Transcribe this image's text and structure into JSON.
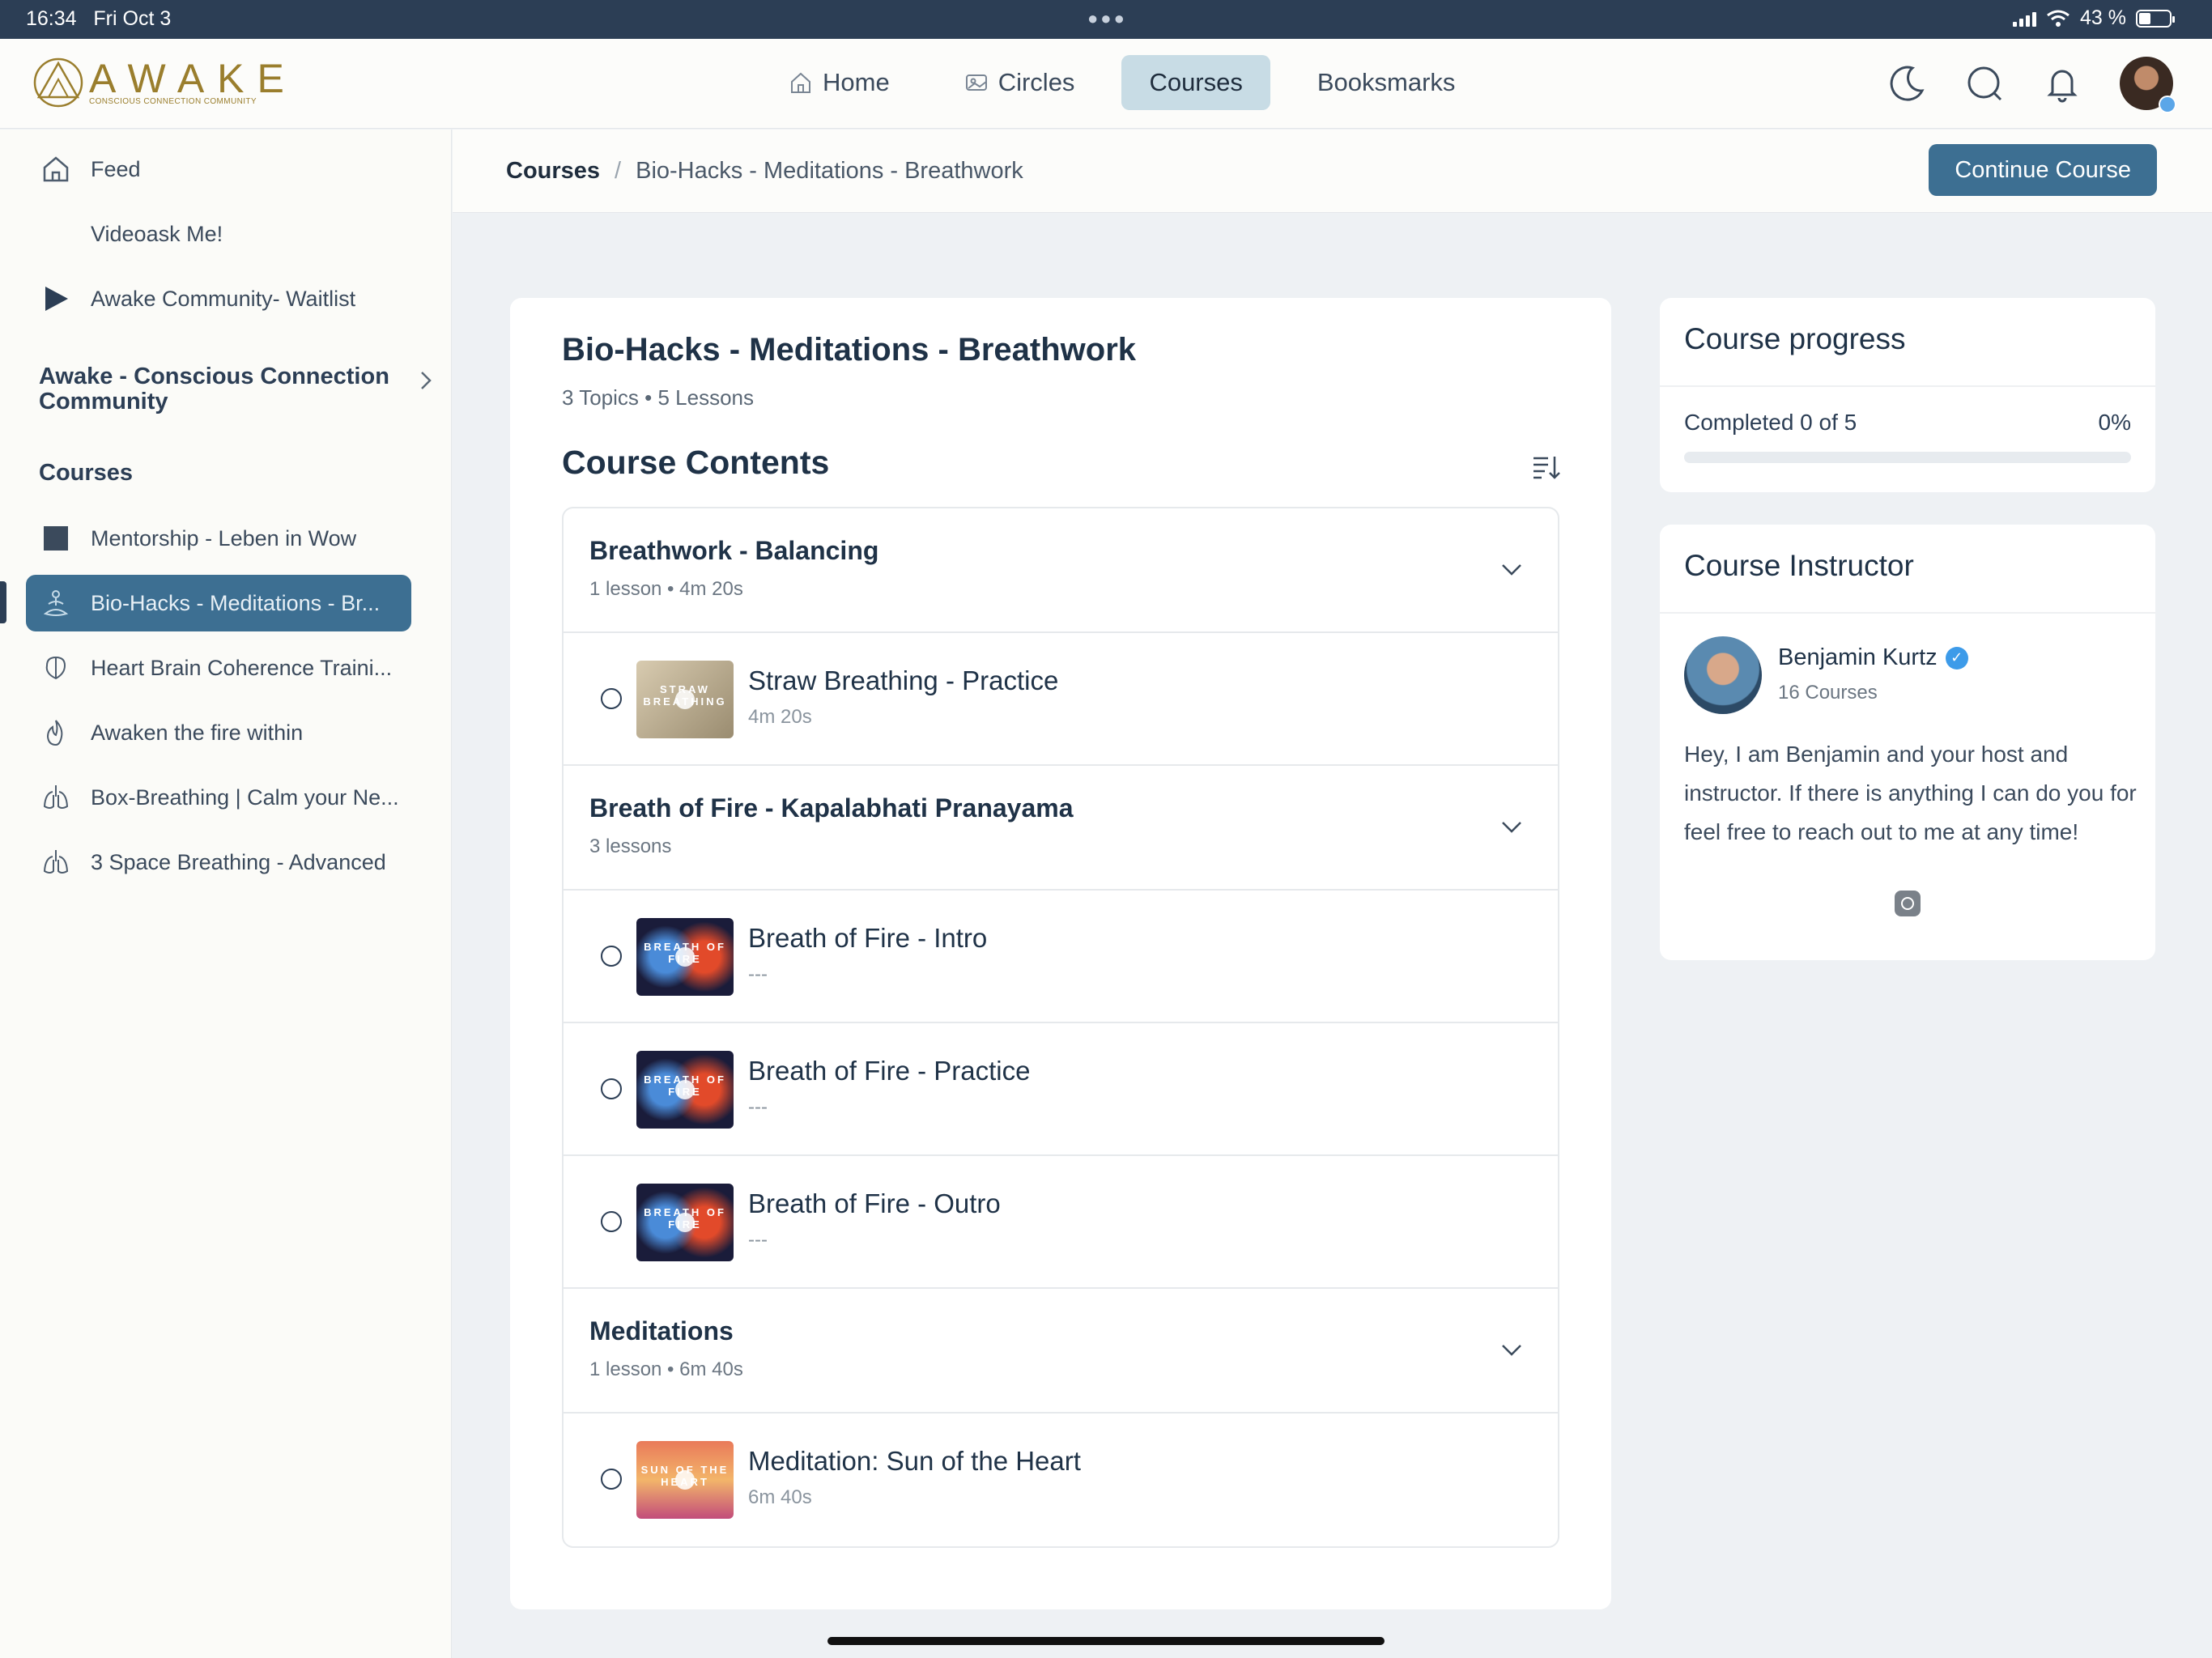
{
  "status": {
    "time": "16:34",
    "date": "Fri Oct 3",
    "battery": "43 %"
  },
  "brand": {
    "name": "AWAKE",
    "tagline": "CONSCIOUS CONNECTION COMMUNITY",
    "color": "#9a7e2d"
  },
  "nav": {
    "items": [
      {
        "label": "Home",
        "icon": "home-icon"
      },
      {
        "label": "Circles",
        "icon": "image-icon"
      },
      {
        "label": "Courses",
        "active": true
      },
      {
        "label": "Booksmarks"
      }
    ],
    "right_icons": [
      "moon-icon",
      "search-icon",
      "bell-icon",
      "avatar"
    ]
  },
  "sidebar": {
    "items": [
      {
        "label": "Feed",
        "icon": "home-icon"
      },
      {
        "label": "Videoask Me!"
      },
      {
        "label": "Awake Community- Waitlist",
        "icon": "play-icon"
      }
    ],
    "community": "Awake - Conscious Connection Community",
    "courses_heading": "Courses",
    "courses": [
      {
        "label": "Mentorship - Leben in Wow",
        "icon": "square-icon"
      },
      {
        "label": "Bio-Hacks - Meditations - Br...",
        "icon": "meditation-icon",
        "active": true
      },
      {
        "label": "Heart Brain Coherence Traini...",
        "icon": "brain-icon"
      },
      {
        "label": "Awaken the fire within",
        "icon": "flame-icon"
      },
      {
        "label": "Box-Breathing | Calm your Ne...",
        "icon": "lungs-icon"
      },
      {
        "label": "3 Space Breathing - Advanced",
        "icon": "lungs-icon"
      }
    ]
  },
  "breadcrumb": {
    "root": "Courses",
    "separator": "/",
    "current": "Bio-Hacks - Meditations - Breathwork"
  },
  "continue_label": "Continue Course",
  "course": {
    "title": "Bio-Hacks - Meditations - Breathwork",
    "meta": "3 Topics • 5 Lessons",
    "contents_title": "Course Contents",
    "topics": [
      {
        "name": "Breathwork - Balancing",
        "meta": "1 lesson • 4m 20s",
        "lessons": [
          {
            "name": "Straw Breathing - Practice",
            "meta": "4m 20s",
            "thumb_text": "STRAW BREATHING",
            "thumb": "straw"
          }
        ]
      },
      {
        "name": "Breath of Fire - Kapalabhati Pranayama",
        "meta": "3 lessons",
        "lessons": [
          {
            "name": "Breath of Fire - Intro",
            "meta": "---",
            "thumb_text": "BREATH OF FIRE",
            "thumb": "fire"
          },
          {
            "name": "Breath of Fire - Practice",
            "meta": "---",
            "thumb_text": "BREATH OF FIRE",
            "thumb": "fire"
          },
          {
            "name": "Breath of Fire - Outro",
            "meta": "---",
            "thumb_text": "BREATH OF FIRE",
            "thumb": "fire"
          }
        ]
      },
      {
        "name": "Meditations",
        "meta": "1 lesson • 6m 40s",
        "lessons": [
          {
            "name": "Meditation: Sun of the Heart",
            "meta": "6m 40s",
            "thumb_text": "SUN OF THE HEART",
            "thumb": "sun"
          }
        ]
      }
    ]
  },
  "progress": {
    "title": "Course progress",
    "label": "Completed 0 of 5",
    "percent_label": "0%",
    "percent": 0
  },
  "instructor": {
    "title": "Course Instructor",
    "name": "Benjamin Kurtz",
    "courses": "16 Courses",
    "bio": "Hey, I am Benjamin and your host and instructor. If there is anything I can do you for feel free to reach out to me at any time!"
  },
  "colors": {
    "accent": "#3d6f92",
    "nav_active": "#c8dce5",
    "statusbar": "#2c3e55"
  }
}
